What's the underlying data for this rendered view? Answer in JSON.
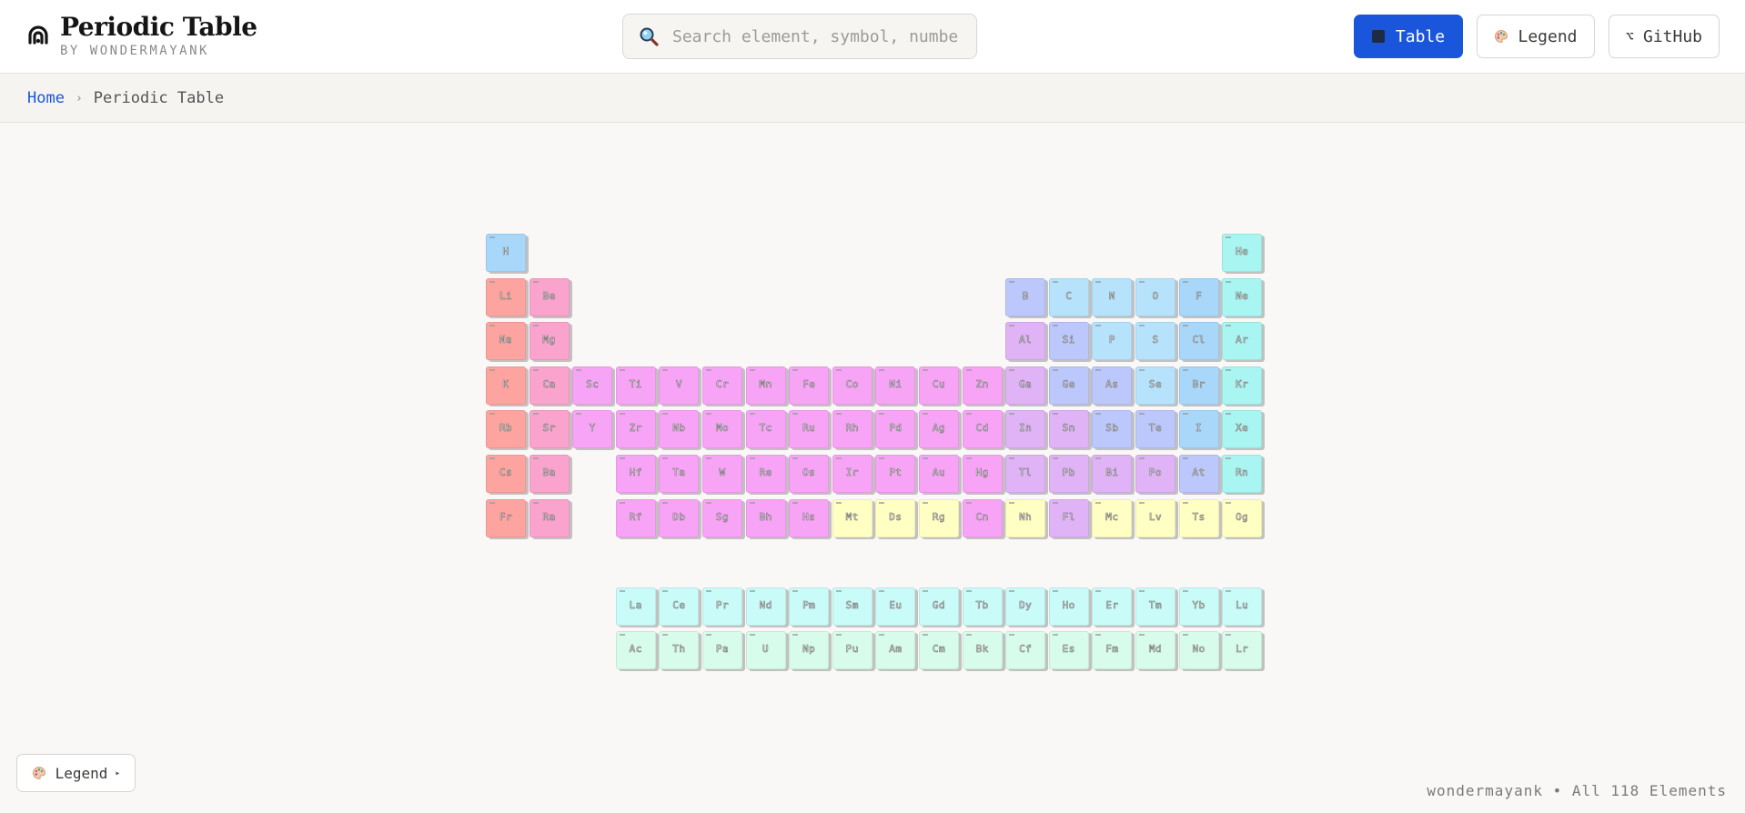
{
  "brand": {
    "title": "Periodic Table",
    "subtitle": "BY WONDERMAYANK",
    "logo_icon": "brain-icon"
  },
  "search": {
    "placeholder": "Search element, symbol, number…",
    "value": ""
  },
  "nav": {
    "table_label": "Table",
    "legend_label": "Legend",
    "github_label": "GitHub",
    "github_glyph": "⌥"
  },
  "breadcrumb": {
    "home": "Home",
    "separator": "›",
    "current": "Periodic Table"
  },
  "legend_toggle": {
    "label": "Legend",
    "arrow": "▸"
  },
  "footer": {
    "text": "wondermayank • All 118 Elements"
  },
  "colors": {
    "alkali": "#fda4a0",
    "alkaline": "#f9a3cd",
    "transition": "#f8a4f6",
    "post_transition": "#dfb3f6",
    "metalloid": "#bcc7fb",
    "nonmetal": "#b6e3fb",
    "halogen": "#a8d7fa",
    "noble": "#a8f5f1",
    "unknown": "#ffffc4",
    "lanthanide": "#c9fbf8",
    "actinide": "#d8fcec",
    "primary": "#1a56db"
  },
  "elements": [
    {
      "s": "H",
      "r": 1,
      "c": 1,
      "cat": "halogen"
    },
    {
      "s": "He",
      "r": 1,
      "c": 18,
      "cat": "noble"
    },
    {
      "s": "Li",
      "r": 2,
      "c": 1,
      "cat": "alkali"
    },
    {
      "s": "Be",
      "r": 2,
      "c": 2,
      "cat": "alkaline"
    },
    {
      "s": "B",
      "r": 2,
      "c": 13,
      "cat": "metalloid"
    },
    {
      "s": "C",
      "r": 2,
      "c": 14,
      "cat": "nonmetal"
    },
    {
      "s": "N",
      "r": 2,
      "c": 15,
      "cat": "nonmetal"
    },
    {
      "s": "O",
      "r": 2,
      "c": 16,
      "cat": "nonmetal"
    },
    {
      "s": "F",
      "r": 2,
      "c": 17,
      "cat": "halogen"
    },
    {
      "s": "Ne",
      "r": 2,
      "c": 18,
      "cat": "noble"
    },
    {
      "s": "Na",
      "r": 3,
      "c": 1,
      "cat": "alkali"
    },
    {
      "s": "Mg",
      "r": 3,
      "c": 2,
      "cat": "alkaline"
    },
    {
      "s": "Al",
      "r": 3,
      "c": 13,
      "cat": "post_transition"
    },
    {
      "s": "Si",
      "r": 3,
      "c": 14,
      "cat": "metalloid"
    },
    {
      "s": "P",
      "r": 3,
      "c": 15,
      "cat": "nonmetal"
    },
    {
      "s": "S",
      "r": 3,
      "c": 16,
      "cat": "nonmetal"
    },
    {
      "s": "Cl",
      "r": 3,
      "c": 17,
      "cat": "halogen"
    },
    {
      "s": "Ar",
      "r": 3,
      "c": 18,
      "cat": "noble"
    },
    {
      "s": "K",
      "r": 4,
      "c": 1,
      "cat": "alkali"
    },
    {
      "s": "Ca",
      "r": 4,
      "c": 2,
      "cat": "alkaline"
    },
    {
      "s": "Sc",
      "r": 4,
      "c": 3,
      "cat": "transition"
    },
    {
      "s": "Ti",
      "r": 4,
      "c": 4,
      "cat": "transition"
    },
    {
      "s": "V",
      "r": 4,
      "c": 5,
      "cat": "transition"
    },
    {
      "s": "Cr",
      "r": 4,
      "c": 6,
      "cat": "transition"
    },
    {
      "s": "Mn",
      "r": 4,
      "c": 7,
      "cat": "transition"
    },
    {
      "s": "Fe",
      "r": 4,
      "c": 8,
      "cat": "transition"
    },
    {
      "s": "Co",
      "r": 4,
      "c": 9,
      "cat": "transition"
    },
    {
      "s": "Ni",
      "r": 4,
      "c": 10,
      "cat": "transition"
    },
    {
      "s": "Cu",
      "r": 4,
      "c": 11,
      "cat": "transition"
    },
    {
      "s": "Zn",
      "r": 4,
      "c": 12,
      "cat": "transition"
    },
    {
      "s": "Ga",
      "r": 4,
      "c": 13,
      "cat": "post_transition"
    },
    {
      "s": "Ge",
      "r": 4,
      "c": 14,
      "cat": "metalloid"
    },
    {
      "s": "As",
      "r": 4,
      "c": 15,
      "cat": "metalloid"
    },
    {
      "s": "Se",
      "r": 4,
      "c": 16,
      "cat": "nonmetal"
    },
    {
      "s": "Br",
      "r": 4,
      "c": 17,
      "cat": "halogen"
    },
    {
      "s": "Kr",
      "r": 4,
      "c": 18,
      "cat": "noble"
    },
    {
      "s": "Rb",
      "r": 5,
      "c": 1,
      "cat": "alkali"
    },
    {
      "s": "Sr",
      "r": 5,
      "c": 2,
      "cat": "alkaline"
    },
    {
      "s": "Y",
      "r": 5,
      "c": 3,
      "cat": "transition"
    },
    {
      "s": "Zr",
      "r": 5,
      "c": 4,
      "cat": "transition"
    },
    {
      "s": "Nb",
      "r": 5,
      "c": 5,
      "cat": "transition"
    },
    {
      "s": "Mo",
      "r": 5,
      "c": 6,
      "cat": "transition"
    },
    {
      "s": "Tc",
      "r": 5,
      "c": 7,
      "cat": "transition"
    },
    {
      "s": "Ru",
      "r": 5,
      "c": 8,
      "cat": "transition"
    },
    {
      "s": "Rh",
      "r": 5,
      "c": 9,
      "cat": "transition"
    },
    {
      "s": "Pd",
      "r": 5,
      "c": 10,
      "cat": "transition"
    },
    {
      "s": "Ag",
      "r": 5,
      "c": 11,
      "cat": "transition"
    },
    {
      "s": "Cd",
      "r": 5,
      "c": 12,
      "cat": "transition"
    },
    {
      "s": "In",
      "r": 5,
      "c": 13,
      "cat": "post_transition"
    },
    {
      "s": "Sn",
      "r": 5,
      "c": 14,
      "cat": "post_transition"
    },
    {
      "s": "Sb",
      "r": 5,
      "c": 15,
      "cat": "metalloid"
    },
    {
      "s": "Te",
      "r": 5,
      "c": 16,
      "cat": "metalloid"
    },
    {
      "s": "I",
      "r": 5,
      "c": 17,
      "cat": "halogen"
    },
    {
      "s": "Xe",
      "r": 5,
      "c": 18,
      "cat": "noble"
    },
    {
      "s": "Cs",
      "r": 6,
      "c": 1,
      "cat": "alkali"
    },
    {
      "s": "Ba",
      "r": 6,
      "c": 2,
      "cat": "alkaline"
    },
    {
      "s": "Hf",
      "r": 6,
      "c": 4,
      "cat": "transition"
    },
    {
      "s": "Ta",
      "r": 6,
      "c": 5,
      "cat": "transition"
    },
    {
      "s": "W",
      "r": 6,
      "c": 6,
      "cat": "transition"
    },
    {
      "s": "Re",
      "r": 6,
      "c": 7,
      "cat": "transition"
    },
    {
      "s": "Os",
      "r": 6,
      "c": 8,
      "cat": "transition"
    },
    {
      "s": "Ir",
      "r": 6,
      "c": 9,
      "cat": "transition"
    },
    {
      "s": "Pt",
      "r": 6,
      "c": 10,
      "cat": "transition"
    },
    {
      "s": "Au",
      "r": 6,
      "c": 11,
      "cat": "transition"
    },
    {
      "s": "Hg",
      "r": 6,
      "c": 12,
      "cat": "transition"
    },
    {
      "s": "Tl",
      "r": 6,
      "c": 13,
      "cat": "post_transition"
    },
    {
      "s": "Pb",
      "r": 6,
      "c": 14,
      "cat": "post_transition"
    },
    {
      "s": "Bi",
      "r": 6,
      "c": 15,
      "cat": "post_transition"
    },
    {
      "s": "Po",
      "r": 6,
      "c": 16,
      "cat": "post_transition"
    },
    {
      "s": "At",
      "r": 6,
      "c": 17,
      "cat": "metalloid"
    },
    {
      "s": "Rn",
      "r": 6,
      "c": 18,
      "cat": "noble"
    },
    {
      "s": "Fr",
      "r": 7,
      "c": 1,
      "cat": "alkali"
    },
    {
      "s": "Ra",
      "r": 7,
      "c": 2,
      "cat": "alkaline"
    },
    {
      "s": "Rf",
      "r": 7,
      "c": 4,
      "cat": "transition"
    },
    {
      "s": "Db",
      "r": 7,
      "c": 5,
      "cat": "transition"
    },
    {
      "s": "Sg",
      "r": 7,
      "c": 6,
      "cat": "transition"
    },
    {
      "s": "Bh",
      "r": 7,
      "c": 7,
      "cat": "transition"
    },
    {
      "s": "Hs",
      "r": 7,
      "c": 8,
      "cat": "transition"
    },
    {
      "s": "Mt",
      "r": 7,
      "c": 9,
      "cat": "unknown"
    },
    {
      "s": "Ds",
      "r": 7,
      "c": 10,
      "cat": "unknown"
    },
    {
      "s": "Rg",
      "r": 7,
      "c": 11,
      "cat": "unknown"
    },
    {
      "s": "Cn",
      "r": 7,
      "c": 12,
      "cat": "transition"
    },
    {
      "s": "Nh",
      "r": 7,
      "c": 13,
      "cat": "unknown"
    },
    {
      "s": "Fl",
      "r": 7,
      "c": 14,
      "cat": "post_transition"
    },
    {
      "s": "Mc",
      "r": 7,
      "c": 15,
      "cat": "unknown"
    },
    {
      "s": "Lv",
      "r": 7,
      "c": 16,
      "cat": "unknown"
    },
    {
      "s": "Ts",
      "r": 7,
      "c": 17,
      "cat": "unknown"
    },
    {
      "s": "Og",
      "r": 7,
      "c": 18,
      "cat": "unknown"
    },
    {
      "s": "La",
      "r": 9,
      "c": 4,
      "cat": "lanthanide"
    },
    {
      "s": "Ce",
      "r": 9,
      "c": 5,
      "cat": "lanthanide"
    },
    {
      "s": "Pr",
      "r": 9,
      "c": 6,
      "cat": "lanthanide"
    },
    {
      "s": "Nd",
      "r": 9,
      "c": 7,
      "cat": "lanthanide"
    },
    {
      "s": "Pm",
      "r": 9,
      "c": 8,
      "cat": "lanthanide"
    },
    {
      "s": "Sm",
      "r": 9,
      "c": 9,
      "cat": "lanthanide"
    },
    {
      "s": "Eu",
      "r": 9,
      "c": 10,
      "cat": "lanthanide"
    },
    {
      "s": "Gd",
      "r": 9,
      "c": 11,
      "cat": "lanthanide"
    },
    {
      "s": "Tb",
      "r": 9,
      "c": 12,
      "cat": "lanthanide"
    },
    {
      "s": "Dy",
      "r": 9,
      "c": 13,
      "cat": "lanthanide"
    },
    {
      "s": "Ho",
      "r": 9,
      "c": 14,
      "cat": "lanthanide"
    },
    {
      "s": "Er",
      "r": 9,
      "c": 15,
      "cat": "lanthanide"
    },
    {
      "s": "Tm",
      "r": 9,
      "c": 16,
      "cat": "lanthanide"
    },
    {
      "s": "Yb",
      "r": 9,
      "c": 17,
      "cat": "lanthanide"
    },
    {
      "s": "Lu",
      "r": 9,
      "c": 18,
      "cat": "lanthanide"
    },
    {
      "s": "Ac",
      "r": 10,
      "c": 4,
      "cat": "actinide"
    },
    {
      "s": "Th",
      "r": 10,
      "c": 5,
      "cat": "actinide"
    },
    {
      "s": "Pa",
      "r": 10,
      "c": 6,
      "cat": "actinide"
    },
    {
      "s": "U",
      "r": 10,
      "c": 7,
      "cat": "actinide"
    },
    {
      "s": "Np",
      "r": 10,
      "c": 8,
      "cat": "actinide"
    },
    {
      "s": "Pu",
      "r": 10,
      "c": 9,
      "cat": "actinide"
    },
    {
      "s": "Am",
      "r": 10,
      "c": 10,
      "cat": "actinide"
    },
    {
      "s": "Cm",
      "r": 10,
      "c": 11,
      "cat": "actinide"
    },
    {
      "s": "Bk",
      "r": 10,
      "c": 12,
      "cat": "actinide"
    },
    {
      "s": "Cf",
      "r": 10,
      "c": 13,
      "cat": "actinide"
    },
    {
      "s": "Es",
      "r": 10,
      "c": 14,
      "cat": "actinide"
    },
    {
      "s": "Fm",
      "r": 10,
      "c": 15,
      "cat": "actinide"
    },
    {
      "s": "Md",
      "r": 10,
      "c": 16,
      "cat": "actinide"
    },
    {
      "s": "No",
      "r": 10,
      "c": 17,
      "cat": "actinide"
    },
    {
      "s": "Lr",
      "r": 10,
      "c": 18,
      "cat": "actinide"
    }
  ]
}
